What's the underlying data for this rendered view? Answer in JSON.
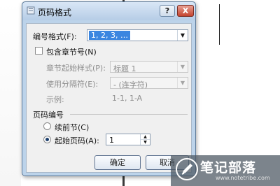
{
  "dialog": {
    "title": "页码格式",
    "help_label": "?",
    "close_label": "X",
    "number_format": {
      "label": "编号格式(F):",
      "value": "1, 2, 3, …"
    },
    "include_chapter": {
      "label": "包含章节号(N)",
      "checked": false
    },
    "chapter_style": {
      "label": "章节起始样式(P):",
      "value": "标题 1"
    },
    "separator": {
      "label": "使用分隔符(E):",
      "value": "-  (连字符)"
    },
    "example": {
      "label": "示例:",
      "value": "1-1, 1-A"
    },
    "page_numbering": {
      "section_label": "页码编号",
      "continue": {
        "label": "续前节(C)",
        "selected": false
      },
      "start_at": {
        "label": "起始页码(A):",
        "selected": true,
        "value": "1"
      }
    },
    "ok_label": "确定",
    "cancel_label": "取消"
  },
  "watermark": {
    "title": "笔记部落",
    "url": "www.notetribe.com"
  }
}
